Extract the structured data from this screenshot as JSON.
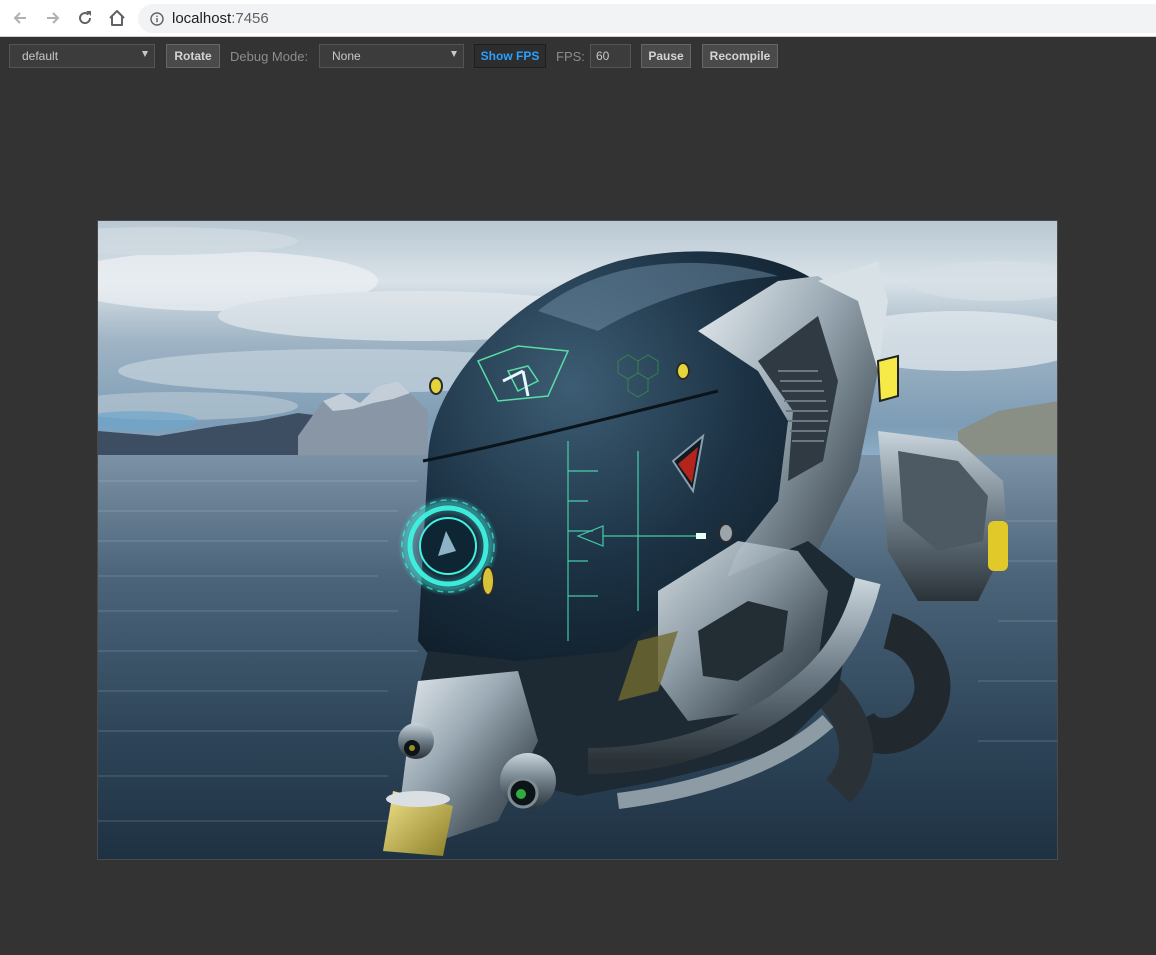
{
  "browser": {
    "url_host": "localhost",
    "url_port": ":7456"
  },
  "toolbar": {
    "scene_select": "default",
    "rotate_label": "Rotate",
    "debug_mode_label": "Debug Mode:",
    "debug_mode_select": "None",
    "show_fps_label": "Show FPS",
    "fps_label": "FPS:",
    "fps_value": "60",
    "pause_label": "Pause",
    "recompile_label": "Recompile"
  },
  "viewport": {
    "content": "sci-fi helmet render over ocean with mountains and cloudy sky"
  },
  "colors": {
    "background": "#333333",
    "show_fps_active": "#2aa0ff",
    "hud_glow": "#3ff2e0"
  }
}
